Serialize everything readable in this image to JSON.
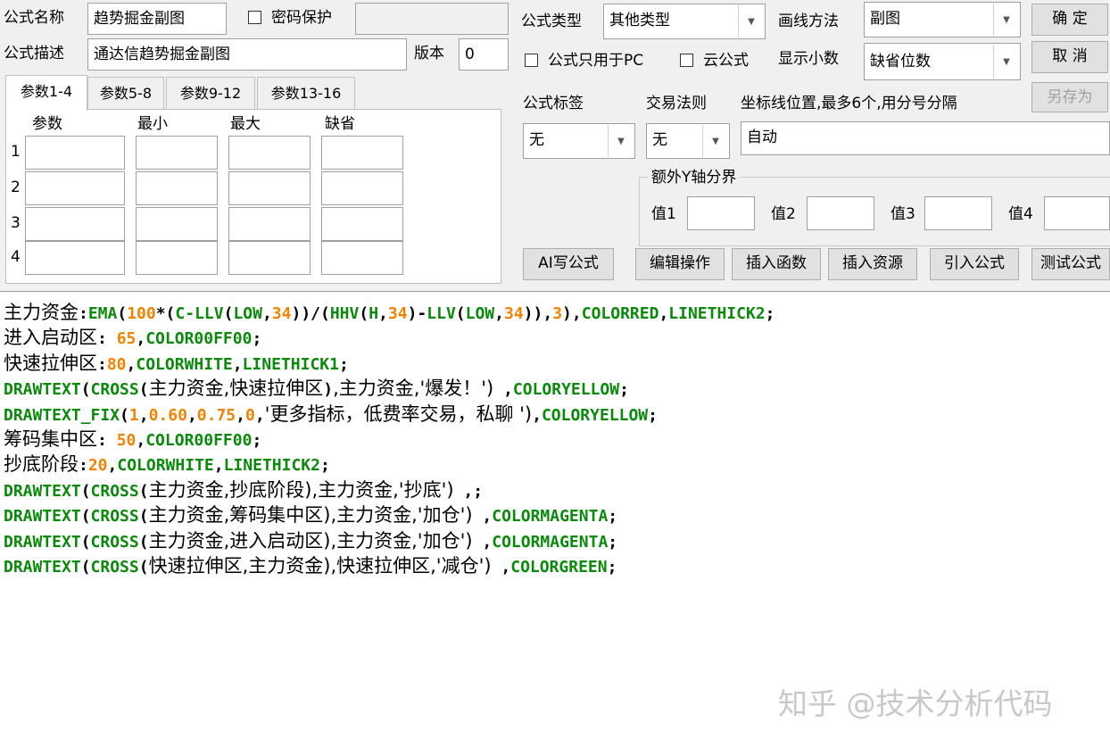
{
  "header": {
    "name_label": "公式名称",
    "name_value": "趋势掘金副图",
    "password_label": "密码保护",
    "desc_label": "公式描述",
    "desc_value": "通达信趋势掘金副图",
    "version_label": "版本",
    "version_value": "0"
  },
  "type_area": {
    "type_label": "公式类型",
    "type_value": "其他类型",
    "draw_label": "画线方法",
    "draw_value": "副图",
    "pc_only_label": "公式只用于PC",
    "cloud_label": "云公式",
    "decimal_label": "显示小数",
    "decimal_value": "缺省位数"
  },
  "buttons": {
    "ok": "确  定",
    "cancel": "取  消",
    "save_as": "另存为"
  },
  "tabs": [
    "参数1-4",
    "参数5-8",
    "参数9-12",
    "参数13-16"
  ],
  "params": {
    "headers": [
      "参数",
      "最小",
      "最大",
      "缺省"
    ],
    "rows": [
      "1",
      "2",
      "3",
      "4"
    ]
  },
  "tags": {
    "tag_label": "公式标签",
    "tag_value": "无",
    "rule_label": "交易法则",
    "rule_value": "无",
    "axis_label": "坐标线位置,最多6个,用分号分隔",
    "axis_value": "自动"
  },
  "extra_y": {
    "title": "额外Y轴分界",
    "v1": "值1",
    "v2": "值2",
    "v3": "值3",
    "v4": "值4"
  },
  "actions": [
    "AI写公式",
    "编辑操作",
    "插入函数",
    "插入资源",
    "引入公式",
    "测试公式"
  ],
  "code_lines": [
    [
      [
        "t",
        "主力资金"
      ],
      [
        "o",
        ":"
      ],
      [
        "k",
        "EMA"
      ],
      [
        "o",
        "("
      ],
      [
        "n",
        "100"
      ],
      [
        "o",
        "*("
      ],
      [
        "k",
        "C-LLV"
      ],
      [
        "o",
        "("
      ],
      [
        "k",
        "LOW"
      ],
      [
        "o",
        ","
      ],
      [
        "n",
        "34"
      ],
      [
        "o",
        "))/("
      ],
      [
        "k",
        "HHV"
      ],
      [
        "o",
        "("
      ],
      [
        "k",
        "H"
      ],
      [
        "o",
        ","
      ],
      [
        "n",
        "34"
      ],
      [
        "o",
        ")-"
      ],
      [
        "k",
        "LLV"
      ],
      [
        "o",
        "("
      ],
      [
        "k",
        "LOW"
      ],
      [
        "o",
        ","
      ],
      [
        "n",
        "34"
      ],
      [
        "o",
        "))"
      ],
      [
        "o",
        ","
      ],
      [
        "n",
        "3"
      ],
      [
        "o",
        "),"
      ],
      [
        "k",
        "COLORRED"
      ],
      [
        "o",
        ","
      ],
      [
        "k",
        "LINETHICK2"
      ],
      [
        "o",
        ";"
      ]
    ],
    [
      [
        "t",
        "进入启动区"
      ],
      [
        "o",
        ": "
      ],
      [
        "n",
        "65"
      ],
      [
        "o",
        ","
      ],
      [
        "k",
        "COLOR00FF00"
      ],
      [
        "o",
        ";"
      ]
    ],
    [
      [
        "t",
        "快速拉伸区"
      ],
      [
        "o",
        ":"
      ],
      [
        "n",
        "80"
      ],
      [
        "o",
        ","
      ],
      [
        "k",
        "COLORWHITE"
      ],
      [
        "o",
        ","
      ],
      [
        "k",
        "LINETHICK1"
      ],
      [
        "o",
        ";"
      ]
    ],
    [
      [
        "k",
        "DRAWTEXT"
      ],
      [
        "o",
        "("
      ],
      [
        "k",
        "CROSS"
      ],
      [
        "o",
        "("
      ],
      [
        "t",
        "主力资金,快速拉伸区"
      ],
      [
        "o",
        ")"
      ],
      [
        "t",
        ",主力资金,'爆发！')"
      ],
      [
        "o",
        " ,"
      ],
      [
        "k",
        "COLORYELLOW"
      ],
      [
        "o",
        ";"
      ]
    ],
    [
      [
        "k",
        "DRAWTEXT_FIX"
      ],
      [
        "o",
        "("
      ],
      [
        "n",
        "1"
      ],
      [
        "o",
        ","
      ],
      [
        "n",
        "0.60"
      ],
      [
        "o",
        ","
      ],
      [
        "n",
        "0.75"
      ],
      [
        "o",
        ","
      ],
      [
        "n",
        "0"
      ],
      [
        "o",
        ","
      ],
      [
        "t",
        "'更多指标，低费率交易，私聊 ')"
      ],
      [
        "o",
        ","
      ],
      [
        "k",
        "COLORYELLOW"
      ],
      [
        "o",
        ";"
      ]
    ],
    [
      [
        "t",
        "筹码集中区"
      ],
      [
        "o",
        ": "
      ],
      [
        "n",
        "50"
      ],
      [
        "o",
        ","
      ],
      [
        "k",
        "COLOR00FF00"
      ],
      [
        "o",
        ";"
      ]
    ],
    [
      [
        "t",
        "抄底阶段"
      ],
      [
        "o",
        ":"
      ],
      [
        "n",
        "20"
      ],
      [
        "o",
        ","
      ],
      [
        "k",
        "COLORWHITE"
      ],
      [
        "o",
        ","
      ],
      [
        "k",
        "LINETHICK2"
      ],
      [
        "o",
        ";"
      ]
    ],
    [
      [
        "k",
        "DRAWTEXT"
      ],
      [
        "o",
        "("
      ],
      [
        "k",
        "CROSS"
      ],
      [
        "o",
        "("
      ],
      [
        "t",
        "主力资金,抄底阶段)"
      ],
      [
        "t",
        ",主力资金,'抄底')"
      ],
      [
        "o",
        " ,;"
      ]
    ],
    [
      [
        "k",
        "DRAWTEXT"
      ],
      [
        "o",
        "("
      ],
      [
        "k",
        "CROSS"
      ],
      [
        "o",
        "("
      ],
      [
        "t",
        "主力资金,筹码集中区)"
      ],
      [
        "t",
        ",主力资金,'加仓')"
      ],
      [
        "o",
        " ,"
      ],
      [
        "k",
        "COLORMAGENTA"
      ],
      [
        "o",
        ";"
      ]
    ],
    [
      [
        "k",
        "DRAWTEXT"
      ],
      [
        "o",
        "("
      ],
      [
        "k",
        "CROSS"
      ],
      [
        "o",
        "("
      ],
      [
        "t",
        "主力资金,进入启动区)"
      ],
      [
        "t",
        ",主力资金,'加仓')"
      ],
      [
        "o",
        " ,"
      ],
      [
        "k",
        "COLORMAGENTA"
      ],
      [
        "o",
        ";"
      ]
    ],
    [
      [
        "k",
        "DRAWTEXT"
      ],
      [
        "o",
        "("
      ],
      [
        "k",
        "CROSS"
      ],
      [
        "o",
        "("
      ],
      [
        "t",
        "快速拉伸区,主力资金)"
      ],
      [
        "t",
        ",快速拉伸区,'减仓')"
      ],
      [
        "o",
        " ,"
      ],
      [
        "k",
        "COLORGREEN"
      ],
      [
        "o",
        ";"
      ]
    ]
  ],
  "watermark": "知乎 @技术分析代码"
}
